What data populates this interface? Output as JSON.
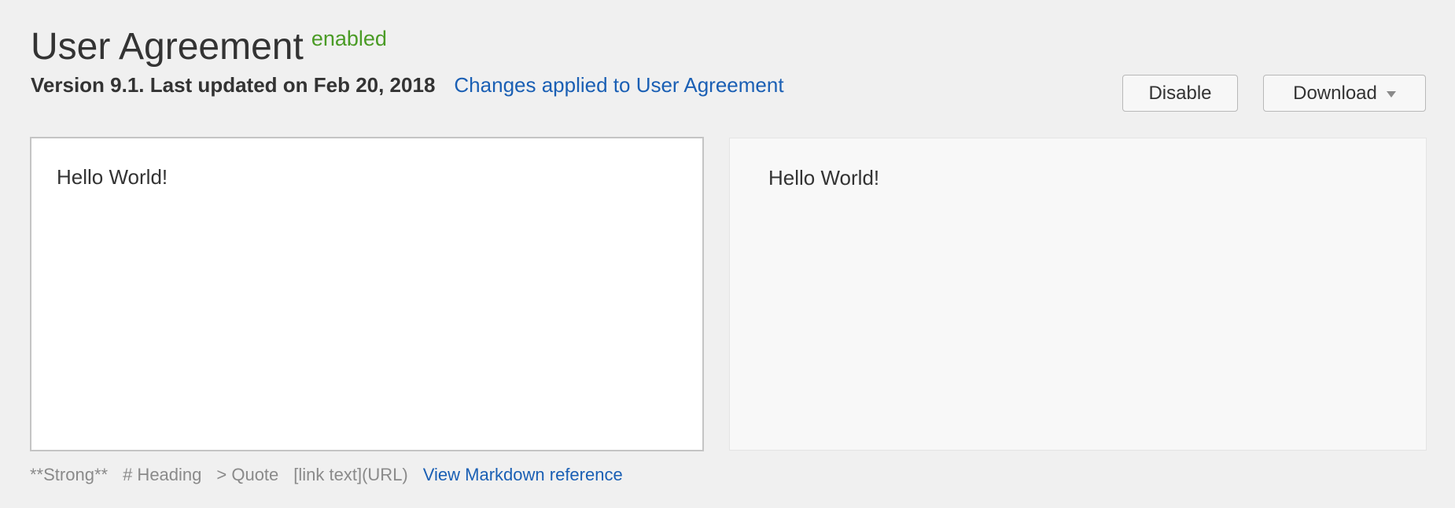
{
  "header": {
    "title": "User Agreement",
    "status": "enabled",
    "version_info": "Version 9.1. Last updated on Feb 20, 2018",
    "changes_link": "Changes applied to User Agreement"
  },
  "actions": {
    "disable_label": "Disable",
    "download_label": "Download"
  },
  "editor": {
    "content": "Hello World!"
  },
  "preview": {
    "content": "Hello World!"
  },
  "markdown_hints": {
    "strong": "**Strong**",
    "heading": "# Heading",
    "quote": "> Quote",
    "link": "[link text](URL)",
    "reference_link": "View Markdown reference"
  },
  "colors": {
    "background": "#f0f0f0",
    "status_enabled": "#4a9b25",
    "link": "#1a5fb4"
  }
}
